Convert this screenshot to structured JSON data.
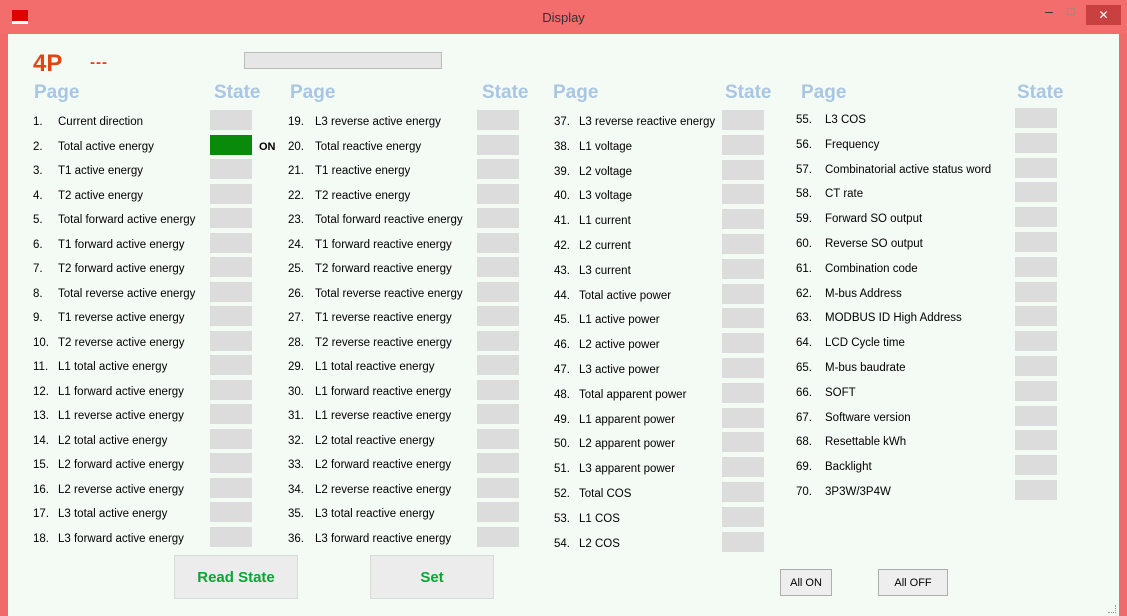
{
  "window": {
    "title": "Display",
    "min_glyph": "–",
    "max_glyph": "□",
    "close_glyph": "✕"
  },
  "header": {
    "model": "4P",
    "dashes": "---",
    "progress_fraction": 0.0
  },
  "columns": [
    {
      "page_label": "Page",
      "state_label": "State"
    },
    {
      "page_label": "Page",
      "state_label": "State"
    },
    {
      "page_label": "Page",
      "state_label": "State"
    },
    {
      "page_label": "Page",
      "state_label": "State"
    }
  ],
  "items": [
    {
      "num": "1.",
      "label": "Current direction",
      "on": false
    },
    {
      "num": "2.",
      "label": "Total active energy",
      "on": true
    },
    {
      "num": "3.",
      "label": "T1 active energy",
      "on": false
    },
    {
      "num": "4.",
      "label": "T2 active energy",
      "on": false
    },
    {
      "num": "5.",
      "label": "Total forward active energy",
      "on": false
    },
    {
      "num": "6.",
      "label": "T1 forward active energy",
      "on": false
    },
    {
      "num": "7.",
      "label": "T2 forward active energy",
      "on": false
    },
    {
      "num": "8.",
      "label": "Total reverse active energy",
      "on": false
    },
    {
      "num": "9.",
      "label": "T1 reverse active energy",
      "on": false
    },
    {
      "num": "10.",
      "label": "T2 reverse active energy",
      "on": false
    },
    {
      "num": "11.",
      "label": "L1 total active energy",
      "on": false
    },
    {
      "num": "12.",
      "label": "L1 forward active energy",
      "on": false
    },
    {
      "num": "13.",
      "label": "L1 reverse active energy",
      "on": false
    },
    {
      "num": "14.",
      "label": "L2 total active energy",
      "on": false
    },
    {
      "num": "15.",
      "label": "L2 forward active energy",
      "on": false
    },
    {
      "num": "16.",
      "label": "L2 reverse active energy",
      "on": false
    },
    {
      "num": "17.",
      "label": "L3 total active energy",
      "on": false
    },
    {
      "num": "18.",
      "label": "L3 forward active energy",
      "on": false
    },
    {
      "num": "19.",
      "label": "L3 reverse active energy",
      "on": false
    },
    {
      "num": "20.",
      "label": "Total reactive energy",
      "on": false
    },
    {
      "num": "21.",
      "label": "T1 reactive energy",
      "on": false
    },
    {
      "num": "22.",
      "label": "T2 reactive energy",
      "on": false
    },
    {
      "num": "23.",
      "label": "Total forward reactive energy",
      "on": false
    },
    {
      "num": "24.",
      "label": "T1 forward reactive energy",
      "on": false
    },
    {
      "num": "25.",
      "label": "T2 forward reactive energy",
      "on": false
    },
    {
      "num": "26.",
      "label": "Total reverse reactive energy",
      "on": false
    },
    {
      "num": "27.",
      "label": "T1 reverse reactive energy",
      "on": false
    },
    {
      "num": "28.",
      "label": "T2 reverse reactive energy",
      "on": false
    },
    {
      "num": "29.",
      "label": "L1 total reactive energy",
      "on": false
    },
    {
      "num": "30.",
      "label": "L1 forward reactive energy",
      "on": false
    },
    {
      "num": "31.",
      "label": "L1 reverse reactive energy",
      "on": false
    },
    {
      "num": "32.",
      "label": "L2 total reactive energy",
      "on": false
    },
    {
      "num": "33.",
      "label": "L2 forward reactive energy",
      "on": false
    },
    {
      "num": "34.",
      "label": "L2 reverse reactive energy",
      "on": false
    },
    {
      "num": "35.",
      "label": "L3 total reactive energy",
      "on": false
    },
    {
      "num": "36.",
      "label": "L3 forward reactive energy",
      "on": false
    },
    {
      "num": "37.",
      "label": "L3 reverse reactive energy",
      "on": false
    },
    {
      "num": "38.",
      "label": "L1 voltage",
      "on": false
    },
    {
      "num": "39.",
      "label": "L2 voltage",
      "on": false
    },
    {
      "num": "40.",
      "label": "L3 voltage",
      "on": false
    },
    {
      "num": "41.",
      "label": "L1 current",
      "on": false
    },
    {
      "num": "42.",
      "label": "L2 current",
      "on": false
    },
    {
      "num": "43.",
      "label": "L3 current",
      "on": false
    },
    {
      "num": "44.",
      "label": "Total active power",
      "on": false
    },
    {
      "num": "45.",
      "label": "L1 active power",
      "on": false
    },
    {
      "num": "46.",
      "label": "L2 active power",
      "on": false
    },
    {
      "num": "47.",
      "label": "L3 active power",
      "on": false
    },
    {
      "num": "48.",
      "label": "Total apparent power",
      "on": false
    },
    {
      "num": "49.",
      "label": "L1 apparent power",
      "on": false
    },
    {
      "num": "50.",
      "label": "L2 apparent power",
      "on": false
    },
    {
      "num": "51.",
      "label": "L3 apparent power",
      "on": false
    },
    {
      "num": "52.",
      "label": "Total COS",
      "on": false
    },
    {
      "num": "53.",
      "label": "L1 COS",
      "on": false
    },
    {
      "num": "54.",
      "label": "L2 COS",
      "on": false
    },
    {
      "num": "55.",
      "label": "L3 COS",
      "on": false
    },
    {
      "num": "56.",
      "label": "Frequency",
      "on": false
    },
    {
      "num": "57.",
      "label": "Combinatorial active status word",
      "on": false
    },
    {
      "num": "58.",
      "label": "CT rate",
      "on": false
    },
    {
      "num": "59.",
      "label": "Forward SO output",
      "on": false
    },
    {
      "num": "60.",
      "label": "Reverse SO output",
      "on": false
    },
    {
      "num": "61.",
      "label": "Combination code",
      "on": false
    },
    {
      "num": "62.",
      "label": "M-bus Address",
      "on": false
    },
    {
      "num": "63.",
      "label": "MODBUS ID   High Address",
      "on": false
    },
    {
      "num": "64.",
      "label": "LCD Cycle time",
      "on": false
    },
    {
      "num": "65.",
      "label": "M-bus baudrate",
      "on": false
    },
    {
      "num": "66.",
      "label": "SOFT",
      "on": false
    },
    {
      "num": "67.",
      "label": "Software version",
      "on": false
    },
    {
      "num": "68.",
      "label": "Resettable kWh",
      "on": false
    },
    {
      "num": "69.",
      "label": "Backlight",
      "on": false
    },
    {
      "num": "70.",
      "label": "3P3W/3P4W",
      "on": false
    }
  ],
  "on_text": "ON",
  "buttons": {
    "read_state": "Read State",
    "set": "Set",
    "all_on": "All ON",
    "all_off": "All OFF"
  },
  "colors": {
    "title_bar": "#f46d6d",
    "accent_orange": "#e2450d",
    "header_blue": "#a9c6e2",
    "state_on": "#0a8a0a",
    "state_off": "#dcdcdc",
    "button_text": "#07a632"
  }
}
